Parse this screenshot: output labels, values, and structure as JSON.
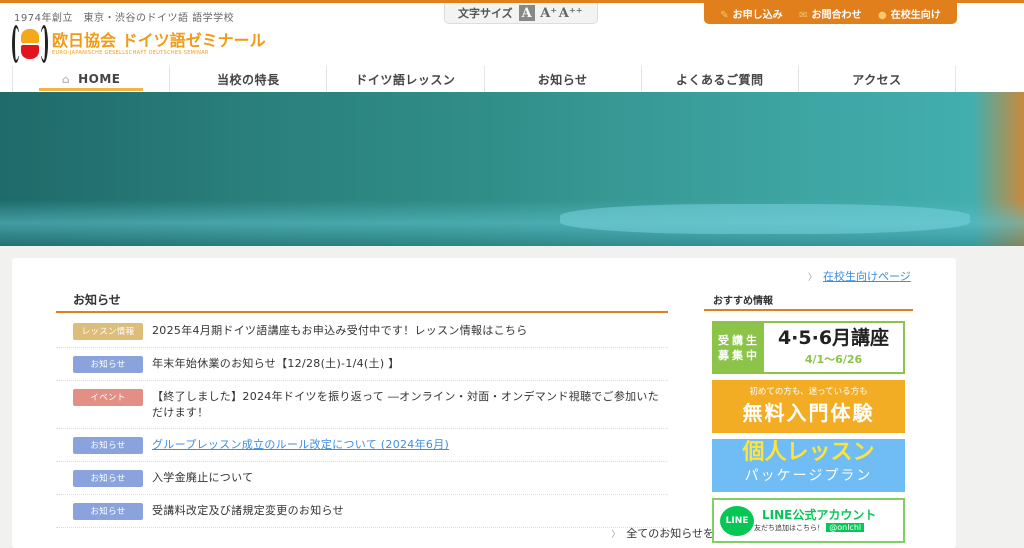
{
  "header": {
    "tagline": "1974年創立　東京・渋谷のドイツ語 語学学校",
    "logo_jp": "欧日協会 ドイツ語ゼミナール",
    "logo_en": "EURO-JAPANISCHE GESELLSCHAFT DEUTSCHES SEMINAR",
    "font_size": {
      "label": "文字サイズ",
      "small": "A",
      "medium": "A⁺",
      "large": "A⁺⁺"
    },
    "util": [
      {
        "icon": "pencil-icon",
        "label": "お申し込み"
      },
      {
        "icon": "mail-icon",
        "label": "お問合わせ"
      },
      {
        "icon": "person-icon",
        "label": "在校生向け"
      }
    ]
  },
  "nav": [
    "HOME",
    "当校の特長",
    "ドイツ語レッスン",
    "お知らせ",
    "よくあるご質問",
    "アクセス"
  ],
  "news": {
    "title": "お知らせ",
    "items": [
      {
        "badge": "レッスン情報",
        "type": "lesson",
        "text": "2025年4月期ドイツ語講座もお申込み受付中です！レッスン情報はこちら"
      },
      {
        "badge": "お知らせ",
        "type": "info",
        "text": "年末年始休業のお知らせ【12/28(土)-1/4(土) 】"
      },
      {
        "badge": "イベント",
        "type": "event",
        "text": "【終了しました】2024年ドイツを振り返って ―オンライン・対面・オンデマンド視聴でご参加いただけます！"
      },
      {
        "badge": "お知らせ",
        "type": "info",
        "text": "グループレッスン成立のルール改定について (2024年6月)",
        "link": true
      },
      {
        "badge": "お知らせ",
        "type": "info",
        "text": "入学金廃止について"
      },
      {
        "badge": "お知らせ",
        "type": "info",
        "text": "受講料改定及び諸規定変更のお知らせ"
      }
    ],
    "more": "全てのお知らせを見る"
  },
  "sidebar": {
    "student_link": "在校生向けページ",
    "title": "おすすめ情報",
    "banner1": {
      "left1": "受講生",
      "left2": "募集中",
      "big": "4·5·6月講座",
      "dates": "4/1〜6/26"
    },
    "banner2": {
      "small": "初めての方も、迷っている方も",
      "big": "無料入門体験"
    },
    "banner3": {
      "big": "個人レッスン",
      "small": "パッケージプラン"
    },
    "banner4": {
      "icon": "LINE",
      "title": "LINE公式アカウント",
      "sub": "友だち追加はこちら！",
      "id": "@onlchl"
    }
  },
  "colors": {
    "accent": "#e07f1c",
    "info": "#8aa3dc",
    "lesson": "#dcbd79",
    "event": "#e38f84"
  }
}
